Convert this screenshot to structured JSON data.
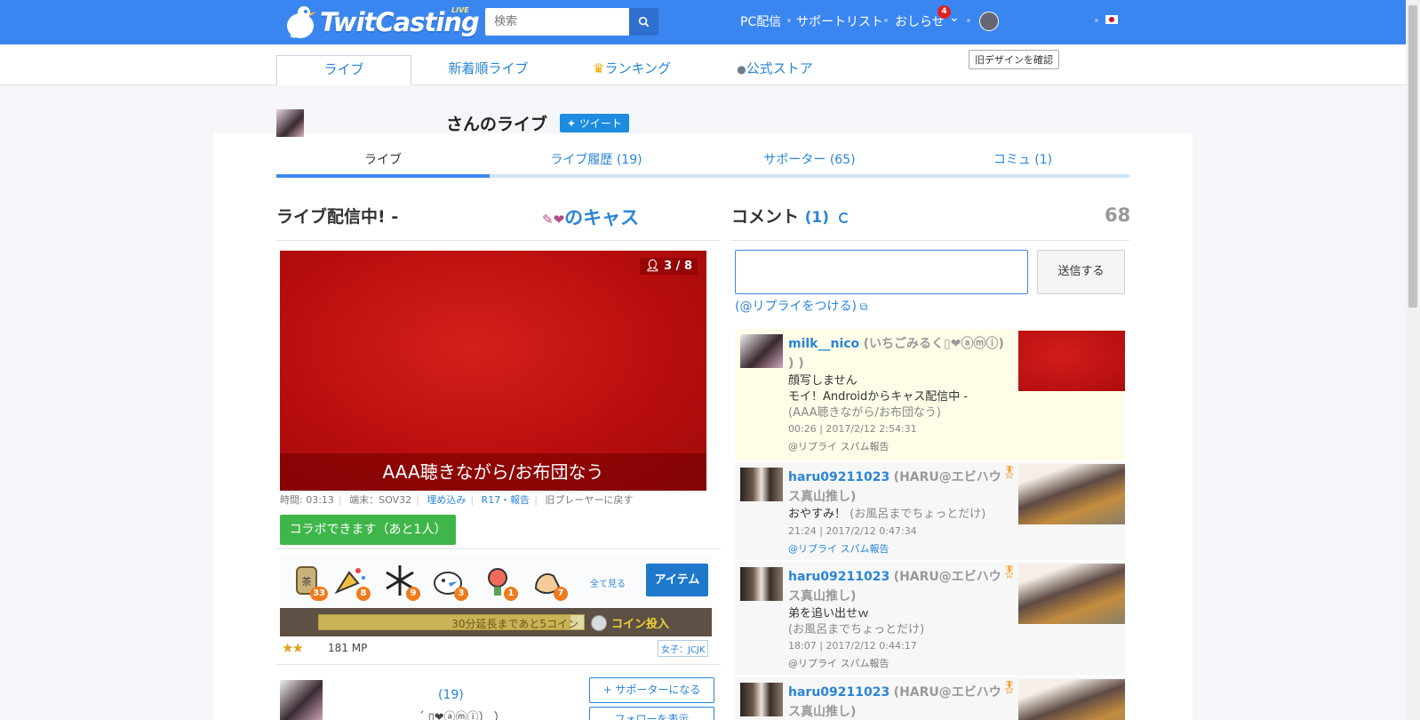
{
  "header": {
    "logo_text": "TwitCasting",
    "logo_live": "LIVE",
    "search_placeholder": "検索",
    "nav": [
      "PC配信",
      "サポートリスト",
      "おしらせ"
    ],
    "notification_count": "4"
  },
  "tabs": {
    "items": [
      "ライブ",
      "新着順ライブ",
      "ランキング",
      "公式ストア"
    ],
    "old_design": "旧デザインを確認"
  },
  "owner": {
    "title": "さんのライブ",
    "tweet": "ツイート"
  },
  "subtabs": {
    "live": "ライブ",
    "history": "ライブ履歴 (19)",
    "supporters": "サポーター (65)",
    "community": "コミュ (1)"
  },
  "live": {
    "heading": "ライブ配信中! -",
    "cas_name": "のキャス",
    "viewer_count": "3 / 8",
    "caption": "AAA聴きながら/お布団なう",
    "meta": {
      "time": "時間: 03:13",
      "device": "端末：SOV32",
      "embed": "埋め込み",
      "report": "R17・報告",
      "old_player": "旧プレーヤーに戻す"
    },
    "collab": "コラボできます（あと1人）",
    "gift_counts": [
      "33",
      "8",
      "9",
      "3",
      "1",
      "7"
    ],
    "see_all": "全て見る",
    "item_button": "アイテム",
    "coin_progress_label": "30分延長まであと5コイン",
    "coin_progress_fraction": 0.95,
    "coin_insert": "コイン投入",
    "stars": "★★",
    "mp": "181 MP",
    "tag": "女子：JCJK"
  },
  "supporter": {
    "count": "(19)",
    "symbols": "´ ▯❤ⓐⓜⓘ） ）",
    "become": "+ サポーターになる",
    "show_follow": "フォローを表示"
  },
  "comments": {
    "heading": "コメント",
    "count": "(1)",
    "total": "68",
    "send": "送信する",
    "reply_link": "(@リプライをつける)",
    "items": [
      {
        "user": "milk__nico",
        "display": "(いちごみるく▯❤ⓐⓜⓘ) ) )",
        "body1": "顔写しません",
        "body2": "モイ！Androidからキャス配信中 -",
        "sub": "(AAA聴きながら/お布団なう)",
        "ts": "00:26 | 2017/2/12 2:54:31",
        "acts": "@リプライ  スパム報告"
      },
      {
        "user": "haru09211023",
        "display": "(HARU@エビハウス真山推し)",
        "body1": "おやすみ！",
        "sub": "(お風呂までちょっとだけ)",
        "ts": "21:24 | 2017/2/12 0:47:34",
        "acts": "@リプライ  スパム報告"
      },
      {
        "user": "haru09211023",
        "display": "(HARU@エビハウス真山推し)",
        "body1": "弟を追い出せｗ",
        "sub": "(お風呂までちょっとだけ)",
        "ts": "18:07 | 2017/2/12 0:44:17",
        "acts": "@リプライ  スパム報告"
      },
      {
        "user": "haru09211023",
        "display": "(HARU@エビハウス真山推し)"
      }
    ]
  }
}
